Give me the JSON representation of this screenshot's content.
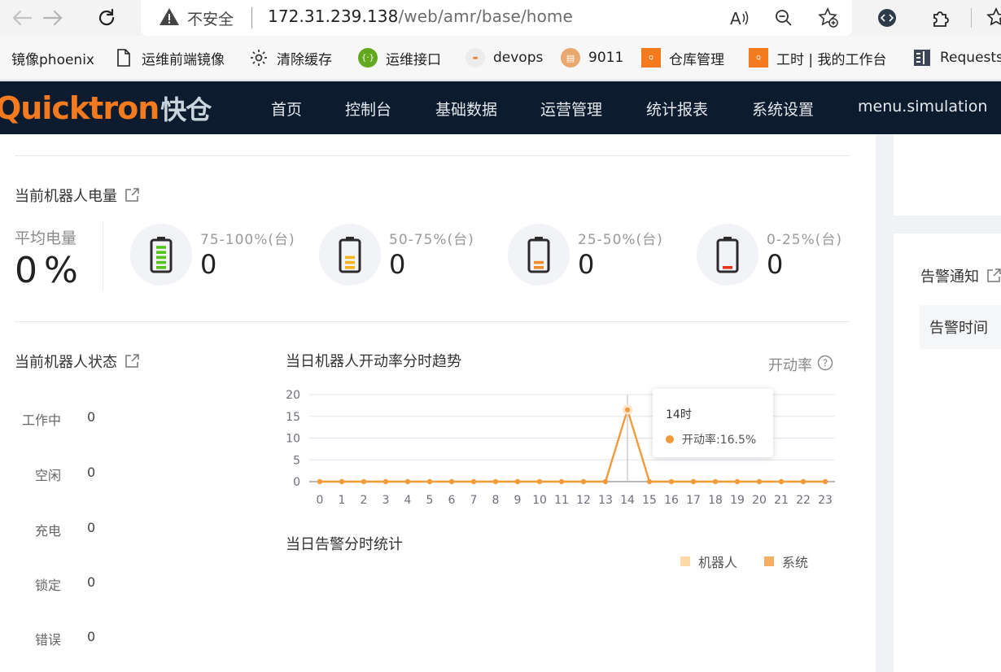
{
  "browser": {
    "security_label": "不安全",
    "url_host": "172.31.239.138",
    "url_path": "/web/amr/base/home"
  },
  "bookmarks": [
    {
      "label": "镜像phoenix"
    },
    {
      "label": "运维前端镜像"
    },
    {
      "label": "清除缓存"
    },
    {
      "label": "运维接口"
    },
    {
      "label": "devops"
    },
    {
      "label": "9011"
    },
    {
      "label": "仓库管理"
    },
    {
      "label": "工时 | 我的工作台"
    },
    {
      "label": "Requests"
    }
  ],
  "header": {
    "logo_text": "Quicktron",
    "logo_cn": "快仓",
    "menu": [
      "首页",
      "控制台",
      "基础数据",
      "运营管理",
      "统计报表",
      "系统设置",
      "menu.simulation"
    ]
  },
  "battery": {
    "title": "当前机器人电量",
    "avg_label": "平均电量",
    "avg_value": "0",
    "avg_unit": "%",
    "levels": [
      {
        "range": "75-100%(台)",
        "count": "0",
        "color": "#52c41a",
        "fill": 1.0
      },
      {
        "range": "50-75%(台)",
        "count": "0",
        "color": "#f5b319",
        "fill": 0.66
      },
      {
        "range": "25-50%(台)",
        "count": "0",
        "color": "#f08a2b",
        "fill": 0.33
      },
      {
        "range": "0-25%(台)",
        "count": "0",
        "color": "#e8341c",
        "fill": 0.12
      }
    ]
  },
  "robot_status": {
    "title": "当前机器人状态",
    "items": [
      {
        "label": "工作中",
        "value": "0"
      },
      {
        "label": "空闲",
        "value": "0"
      },
      {
        "label": "充电",
        "value": "0"
      },
      {
        "label": "锁定",
        "value": "0"
      },
      {
        "label": "错误",
        "value": "0"
      }
    ]
  },
  "trend": {
    "title": "当日机器人开动率分时趋势",
    "metric_label": "开动率",
    "tooltip": {
      "title": "14时",
      "text": "开动率:16.5%"
    }
  },
  "chart_data": {
    "type": "line",
    "x": [
      0,
      1,
      2,
      3,
      4,
      5,
      6,
      7,
      8,
      9,
      10,
      11,
      12,
      13,
      14,
      15,
      16,
      17,
      18,
      19,
      20,
      21,
      22,
      23
    ],
    "series": [
      {
        "name": "开动率",
        "values": [
          0,
          0,
          0,
          0,
          0,
          0,
          0,
          0,
          0,
          0,
          0,
          0,
          0,
          0,
          16.5,
          0,
          0,
          0,
          0,
          0,
          0,
          0,
          0,
          0
        ]
      }
    ],
    "ylim": [
      0,
      20
    ],
    "yticks": [
      0,
      5,
      10,
      15,
      20
    ],
    "color": "#f39a3c",
    "grid": true
  },
  "alarm_stats": {
    "title": "当日告警分时统计",
    "legend": [
      {
        "name": "机器人",
        "color": "#fddba9"
      },
      {
        "name": "系统",
        "color": "#f5b063"
      }
    ]
  },
  "alarm_notice": {
    "title": "告警通知",
    "column": "告警时间"
  }
}
